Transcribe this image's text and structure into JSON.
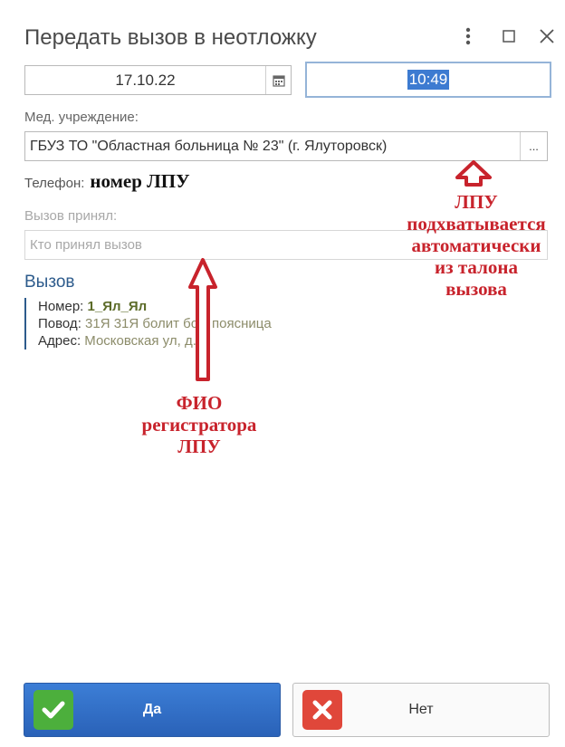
{
  "window": {
    "title": "Передать вызов в неотложку",
    "menu_icon": "kebab-menu-icon",
    "maximize_icon": "maximize-icon",
    "close_icon": "close-icon"
  },
  "form": {
    "date_value": "17.10.22",
    "time_value": "10:49",
    "lpu_label": "Мед. учреждение:",
    "lpu_value": "ГБУЗ ТО \"Областная больница № 23\" (г. Ялуторовск)",
    "lpu_select_button": "...",
    "phone_label": "Телефон:",
    "accepted_label": "Вызов принял:",
    "accepted_placeholder": "Кто принял вызов"
  },
  "call": {
    "section_title": "Вызов",
    "number_label": "Номер:",
    "number_value": "1_Ял_Ял",
    "reason_label": "Повод:",
    "reason_value": "31Я 31Я болит бок, поясница",
    "address_label": "Адрес:",
    "address_value": "Московская ул, д. 5"
  },
  "annotations": {
    "phone_note": "номер ЛПУ",
    "lpu_note": [
      "ЛПУ",
      "подхватывается",
      "автоматически",
      "из талона",
      "вызова"
    ],
    "registrar_note": [
      "ФИО",
      "регистратора",
      "ЛПУ"
    ]
  },
  "buttons": {
    "yes_label": "Да",
    "no_label": "Нет"
  },
  "colors": {
    "accent": "#2d5b8c",
    "yes_button": "#3c7ed6",
    "annotation": "#c8232c"
  }
}
